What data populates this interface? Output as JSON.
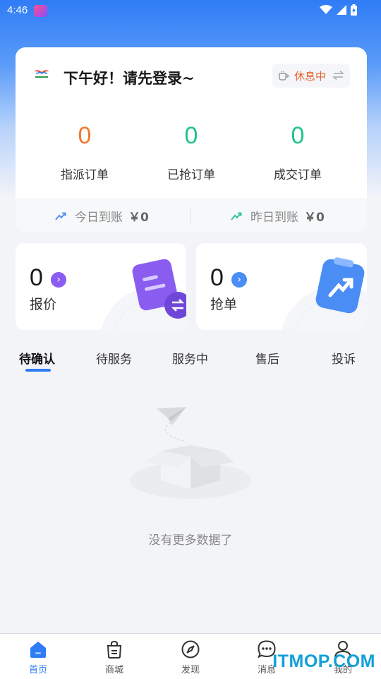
{
  "status_bar": {
    "time": "4:46"
  },
  "header": {
    "greeting": "下午好！请先登录~",
    "status_label": "休息中"
  },
  "stats": [
    {
      "value": "0",
      "label": "指派订单",
      "color": "#f07a2e"
    },
    {
      "value": "0",
      "label": "已抢订单",
      "color": "#21c38a"
    },
    {
      "value": "0",
      "label": "成交订单",
      "color": "#21c38a"
    }
  ],
  "income": {
    "today_label": "今日到账",
    "today_value": "￥0",
    "yesterday_label": "昨日到账",
    "yesterday_value": "￥0"
  },
  "cards": [
    {
      "value": "0",
      "label": "报价",
      "accent": "#8a5cf0"
    },
    {
      "value": "0",
      "label": "抢单",
      "accent": "#4a8df5"
    }
  ],
  "tabs": [
    "待确认",
    "待服务",
    "服务中",
    "售后",
    "投诉"
  ],
  "empty": {
    "text": "没有更多数据了"
  },
  "nav": [
    {
      "label": "首页",
      "icon": "home-icon"
    },
    {
      "label": "商城",
      "icon": "shopping-bag-icon"
    },
    {
      "label": "发现",
      "icon": "compass-icon"
    },
    {
      "label": "消息",
      "icon": "chat-icon"
    },
    {
      "label": "我的",
      "icon": "user-icon"
    }
  ],
  "watermark": "ITMOP.COM"
}
